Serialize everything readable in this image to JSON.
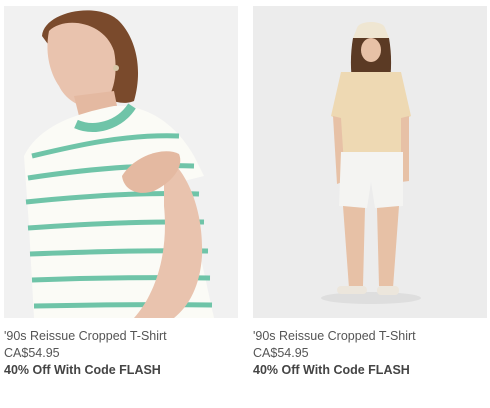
{
  "products": [
    {
      "name": "'90s Reissue Cropped T-Shirt",
      "price": "CA$54.95",
      "promo": "40% Off With Code FLASH",
      "image_icon": "model-green-striped-tee-photo",
      "colors": {
        "background": "#f1f1f1",
        "stripe": "#6fc4a8",
        "shirt": "#fbfbf6"
      }
    },
    {
      "name": "'90s Reissue Cropped T-Shirt",
      "price": "CA$54.95",
      "promo": "40% Off With Code FLASH",
      "image_icon": "model-beige-checked-tee-photo",
      "colors": {
        "background": "#ececec",
        "shirt": "#eed9b3",
        "shorts": "#f4f4f2"
      }
    }
  ]
}
